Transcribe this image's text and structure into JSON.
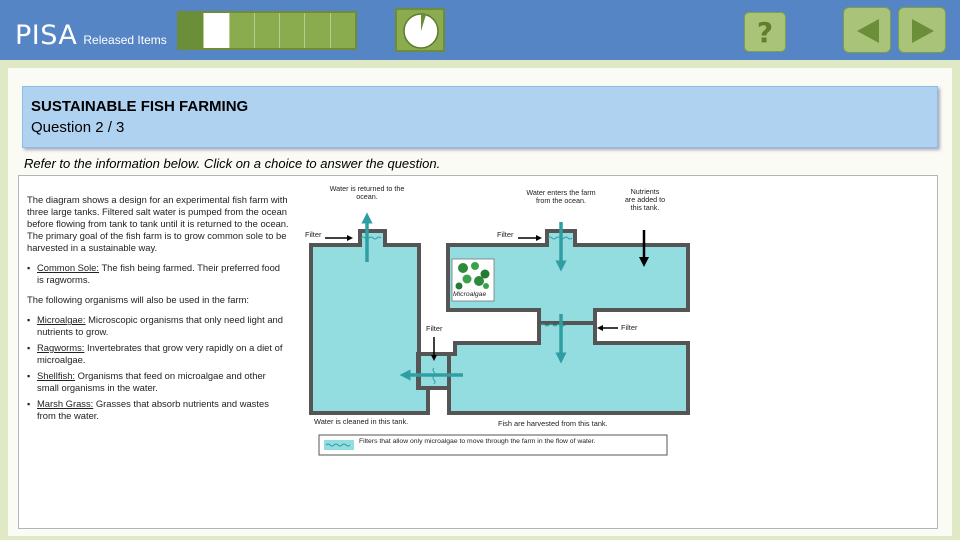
{
  "app": {
    "brand": "PISA",
    "subtitle": "Released Items"
  },
  "progress": {
    "total_segments": 7,
    "current_segment": 2
  },
  "question": {
    "unit_title": "SUSTAINABLE FISH FARMING",
    "counter": "Question 2 / 3",
    "instruction": "Refer to the information below. Click on a choice to answer the question."
  },
  "stimulus": {
    "intro": "The diagram shows a design for an experimental fish farm with three large tanks. Filtered salt water is pumped from the ocean before flowing from tank to tank until it is returned to the ocean. The primary goal of the fish farm is to grow common sole to be harvested in a sustainable way.",
    "sole": {
      "term": "Common Sole:",
      "text": " The fish being farmed. Their preferred food is ragworms."
    },
    "also": "The following organisms will also be used in the farm:",
    "organisms": [
      {
        "term": "Microalgae:",
        "text": " Microscopic organisms that only need light and nutrients to grow."
      },
      {
        "term": "Ragworms:",
        "text": " Invertebrates that grow very rapidly on a diet of microalgae."
      },
      {
        "term": "Shellfish:",
        "text": " Organisms that feed on microalgae and other small organisms in the water."
      },
      {
        "term": "Marsh Grass:",
        "text": " Grasses that absorb nutrients and wastes from the water."
      }
    ]
  },
  "diagram": {
    "returned": [
      "Water is returned to the",
      "ocean."
    ],
    "enters": [
      "Water enters the farm",
      "from the ocean."
    ],
    "nutrients": [
      "Nutrients",
      "are added to",
      "this tank."
    ],
    "filter": "Filter",
    "microalgae": "Microalgae",
    "cleaned": "Water is cleaned in this tank.",
    "harvested": "Fish are harvested from this tank.",
    "legend": "Filters that allow only microalgae to move through the farm in the flow of water."
  },
  "colors": {
    "topbar": "#5585c4",
    "water": "#93dde0",
    "flow_arrow": "#2f9ea3",
    "button": "#a9c479",
    "button_icon": "#6b8e38"
  }
}
